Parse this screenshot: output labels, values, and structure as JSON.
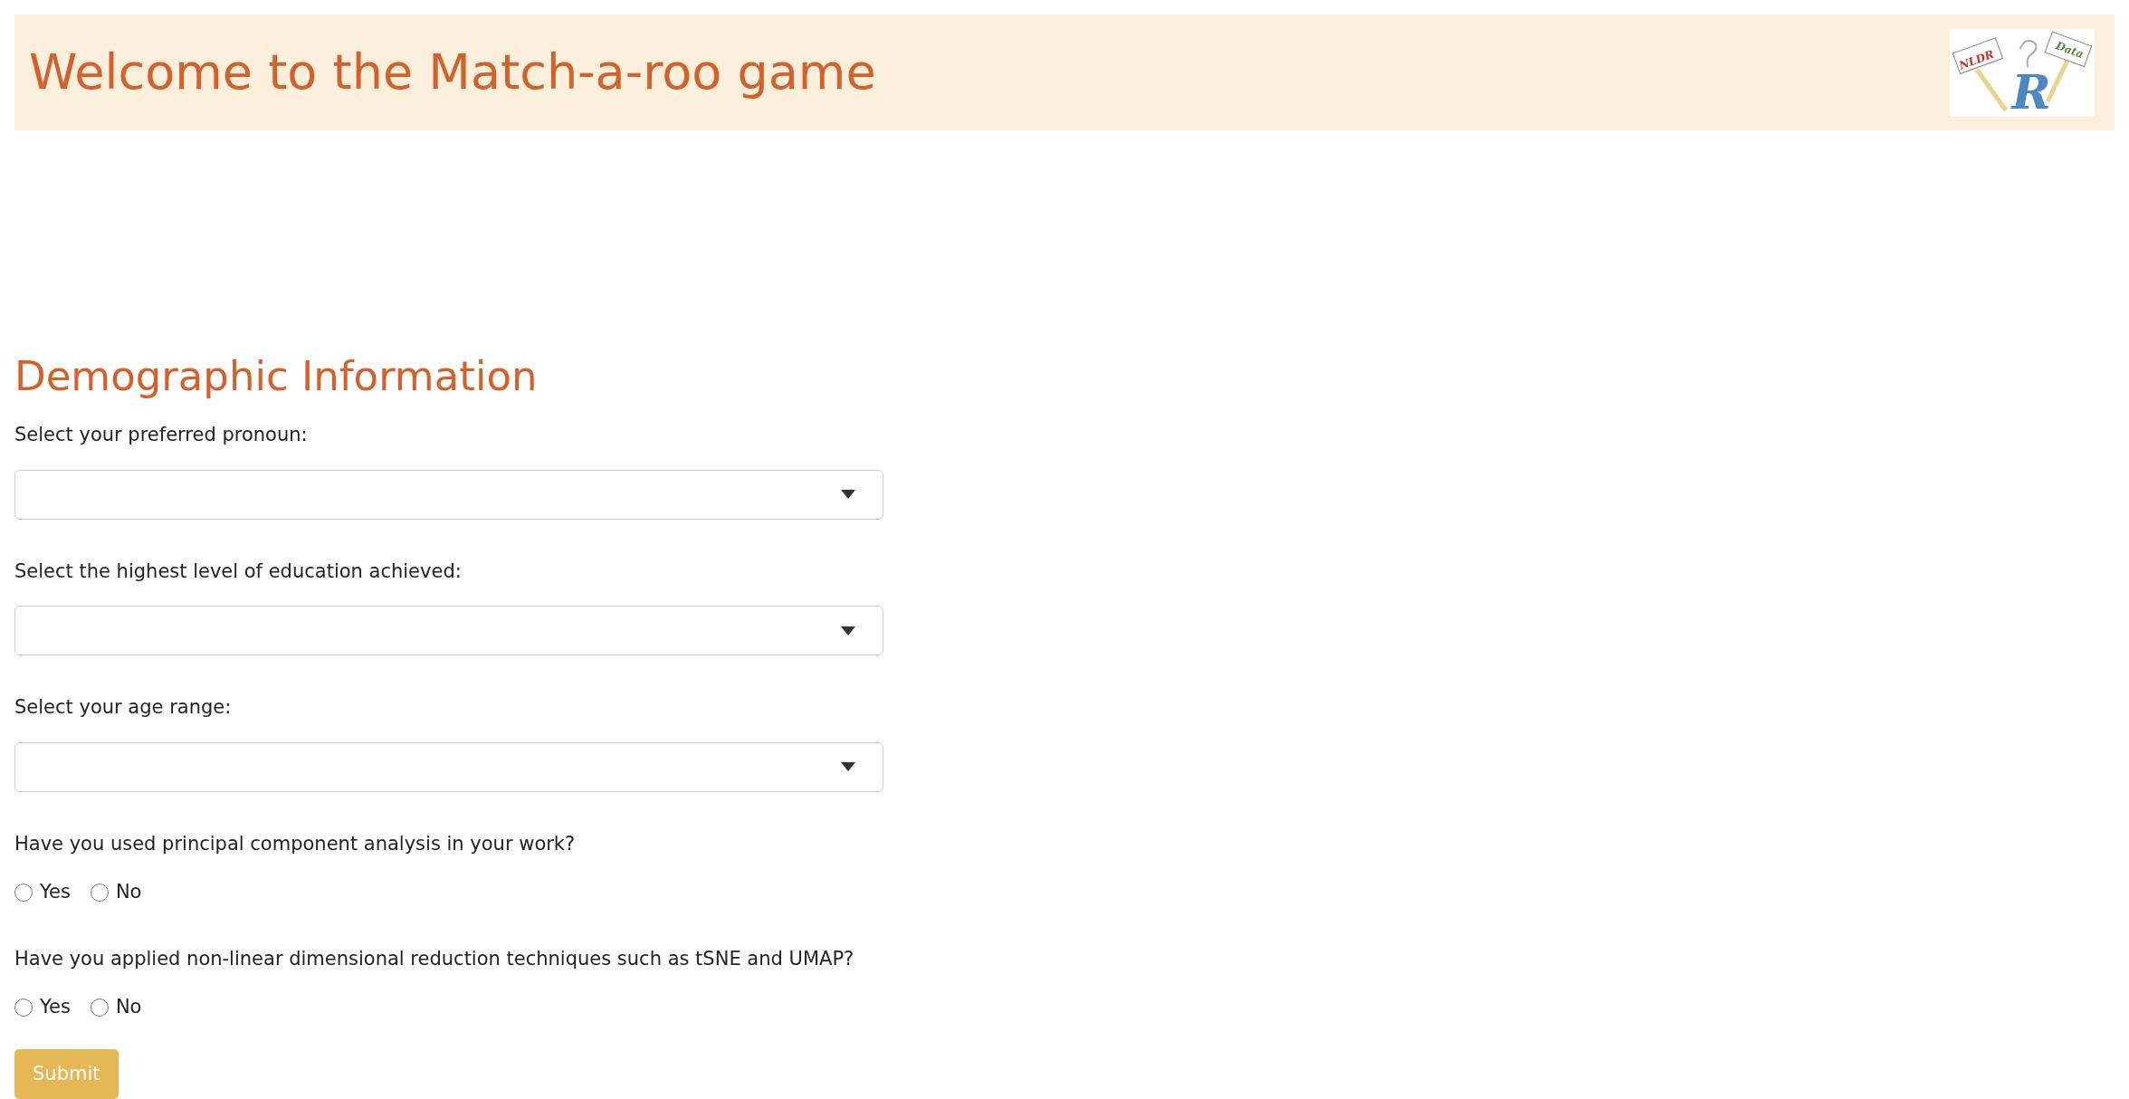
{
  "header": {
    "title": "Welcome to the Match-a-roo game",
    "logo": {
      "signs": [
        "NLDR",
        "Data"
      ],
      "letter": "R"
    }
  },
  "section": {
    "title": "Demographic Information"
  },
  "fields": [
    {
      "kind": "select",
      "label": "Select your preferred pronoun:"
    },
    {
      "kind": "select",
      "label": "Select the highest level of education achieved:"
    },
    {
      "kind": "select",
      "label": "Select your age range:"
    },
    {
      "kind": "radio",
      "label": "Have you used principal component analysis in your work?",
      "options": [
        {
          "label": "Yes",
          "selected": false
        },
        {
          "label": "No",
          "selected": false
        }
      ]
    },
    {
      "kind": "radio",
      "label": "Have you applied non-linear dimensional reduction techniques such as tSNE and UMAP?",
      "options": [
        {
          "label": "Yes",
          "selected": false
        },
        {
          "label": "No",
          "selected": false
        }
      ]
    }
  ],
  "submit": {
    "label": "Submit"
  }
}
